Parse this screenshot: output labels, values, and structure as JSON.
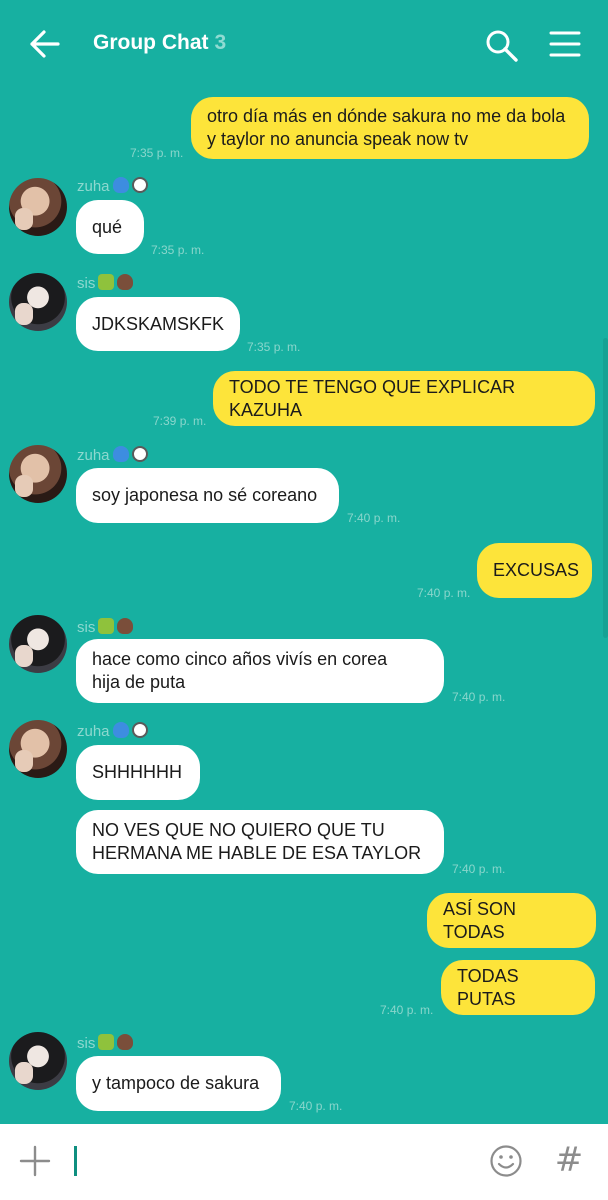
{
  "header": {
    "title": "Group Chat",
    "member_count": "3"
  },
  "messages": [
    {
      "sender": "me",
      "text_lines": [
        "otro día más en dónde sakura no me da bola",
        "y taylor no anuncia speak now tv"
      ],
      "time": "7:35 p. m."
    },
    {
      "sender": "zuha",
      "text": "qué",
      "time": "7:35 p. m."
    },
    {
      "sender": "sis",
      "text": "JDKSKAMSKFK",
      "time": "7:35 p. m."
    },
    {
      "sender": "me",
      "text": "TODO TE TENGO QUE EXPLICAR KAZUHA",
      "time": "7:39 p. m."
    },
    {
      "sender": "zuha",
      "text": "soy japonesa no sé coreano",
      "time": "7:40 p. m."
    },
    {
      "sender": "me",
      "text": "EXCUSAS",
      "time": "7:40 p. m."
    },
    {
      "sender": "sis",
      "text_lines": [
        "hace como cinco años vivís en corea",
        "hija de puta"
      ],
      "time": "7:40 p. m."
    },
    {
      "sender": "zuha",
      "text": "SHHHHHH"
    },
    {
      "sender": "zuha",
      "text_lines": [
        "NO VES QUE NO QUIERO QUE TU",
        "HERMANA ME HABLE DE ESA TAYLOR"
      ],
      "time": "7:40 p. m."
    },
    {
      "sender": "me",
      "text": "ASÍ SON TODAS"
    },
    {
      "sender": "me",
      "text": "TODAS PUTAS",
      "time": "7:40 p. m."
    },
    {
      "sender": "sis",
      "text": "y tampoco de sakura",
      "time": "7:40 p. m."
    }
  ],
  "senders": {
    "zuha": {
      "name": "zuha",
      "emojis": [
        "blue-heart-icon",
        "dog-face-icon"
      ]
    },
    "sis": {
      "name": "sis",
      "emojis": [
        "cat-face-icon",
        "brown-heart-icon"
      ]
    }
  },
  "composer": {
    "hash_symbol": "#"
  },
  "colors": {
    "background": "#17b0a1",
    "outgoing_bubble": "#fde43a",
    "incoming_bubble": "#ffffff",
    "composer_bg": "#ffffff"
  }
}
